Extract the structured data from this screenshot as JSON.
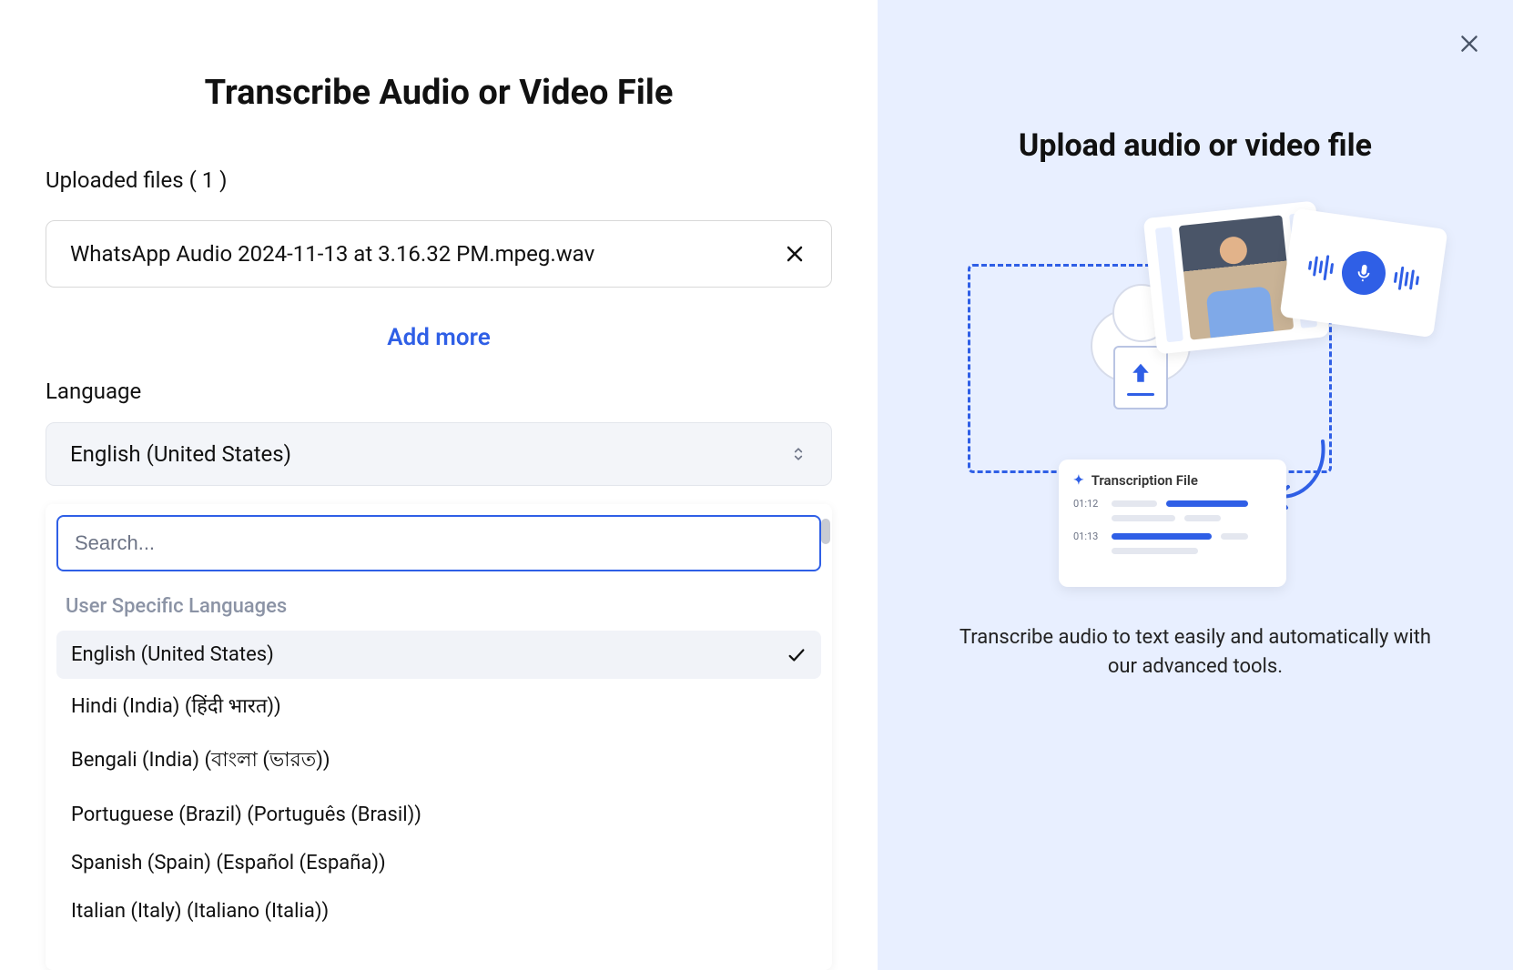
{
  "left": {
    "title": "Transcribe Audio or Video File",
    "uploaded_label": "Uploaded files ( 1 )",
    "file_name": "WhatsApp Audio 2024-11-13 at 3.16.32 PM.mpeg.wav",
    "add_more": "Add more",
    "language_label": "Language",
    "selected_language": "English (United States)",
    "search_placeholder": "Search...",
    "group_header": "User Specific Languages",
    "languages": [
      "English (United States)",
      "Hindi (India) (हिंदी भारत))",
      "Bengali (India) (বাংলা (ভারত))",
      "Portuguese (Brazil) (Português (Brasil))",
      "Spanish (Spain) (Español (España))",
      "Italian (Italy) (Italiano (Italia))"
    ]
  },
  "right": {
    "title": "Upload audio or video file",
    "transcription_card_title": "Transcription File",
    "ts1": "01:12",
    "ts2": "01:13",
    "description": "Transcribe audio to text easily and automatically with our advanced tools."
  }
}
